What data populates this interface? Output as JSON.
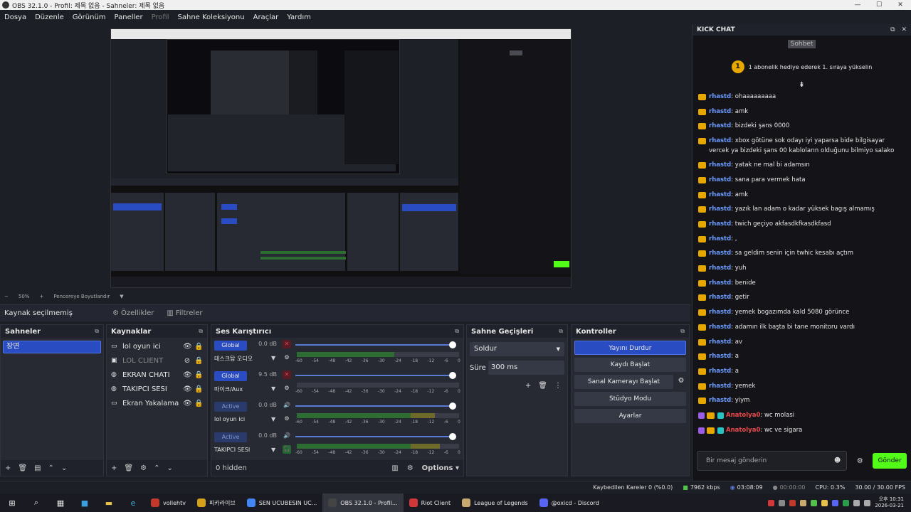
{
  "window": {
    "title": "OBS 32.1.0 - Profil: 제목 없음 - Sahneler: 제목 없음"
  },
  "menu": [
    "Dosya",
    "Düzenle",
    "Görünüm",
    "Paneller",
    "Profil",
    "Sahne Koleksiyonu",
    "Araçlar",
    "Yardım"
  ],
  "preview": {
    "zoom": "50%",
    "resize_label": "Pencereye Boyutlandır"
  },
  "context": {
    "label": "Kaynak seçilmemiş",
    "properties": "Özellikler",
    "filters": "Filtreler"
  },
  "scenes": {
    "title": "Sahneler",
    "items": [
      "장면"
    ]
  },
  "sources": {
    "title": "Kaynaklar",
    "items": [
      {
        "name": "lol oyun ici",
        "icon": "monitor-icon"
      },
      {
        "name": "LOL CLIENT",
        "icon": "window-icon"
      },
      {
        "name": "EKRAN CHATI",
        "icon": "browser-icon"
      },
      {
        "name": "TAKIPCI SESI",
        "icon": "browser-icon"
      },
      {
        "name": "Ekran Yakalama",
        "icon": "monitor-icon"
      }
    ]
  },
  "mixer": {
    "title": "Ses Karıştırıcı",
    "hidden": "0 hidden",
    "options": "Options",
    "channels": [
      {
        "badge": "Global",
        "db": "0.0 dB",
        "name": "데스크탑 오디오",
        "level": 0.6
      },
      {
        "badge": "Global",
        "db": "9.5 dB",
        "name": "마이크/Aux",
        "level": 0.0
      },
      {
        "badge": "Active",
        "db": "0.0 dB",
        "name": "lol oyun ici",
        "level": 0.85
      },
      {
        "badge": "Active",
        "db": "0.0 dB",
        "name": "TAKIPCI SESI",
        "level": 0.88
      }
    ],
    "ticks": [
      "-60",
      "-54",
      "-48",
      "-42",
      "-36",
      "-30",
      "-24",
      "-18",
      "-12",
      "-6",
      "0"
    ]
  },
  "transitions": {
    "title": "Sahne Geçişleri",
    "selected": "Soldur",
    "duration_label": "Süre",
    "duration": "300 ms"
  },
  "controls": {
    "title": "Kontroller",
    "stop_stream": "Yayını Durdur",
    "start_record": "Kaydı Başlat",
    "virtual_cam": "Sanal Kamerayı Başlat",
    "studio_mode": "Stüdyo Modu",
    "settings": "Ayarlar"
  },
  "status": {
    "dropped": "Kaybedilen Kareler 0 (%0.0)",
    "bitrate": "7962 kbps",
    "stream_time": "03:08:09",
    "rec_time": "00:00:00",
    "cpu": "CPU: 0.3%",
    "fps": "30.00 / 30.00 FPS"
  },
  "chat": {
    "title": "KICK CHAT",
    "tab": "Sohbet",
    "gift_rank": "1",
    "gift_text": "1 abonelik hediye ederek 1. sıraya yükselin",
    "messages": [
      {
        "user": "rhastd",
        "text": ": ohaaaaaaaaa"
      },
      {
        "user": "rhastd",
        "text": ": amk"
      },
      {
        "user": "rhastd",
        "text": ": bizdeki şans 0000"
      },
      {
        "user": "rhastd",
        "text": ": xbox götüne sok odayı iyi yaparsa bide bilgisayar vercek ya bizdeki şans 00 kabloların olduğunu bilmiyo salako",
        "wrap": true
      },
      {
        "user": "rhastd",
        "text": ": yatak ne mal bi adamsın"
      },
      {
        "user": "rhastd",
        "text": ": sana para vermek hata"
      },
      {
        "user": "rhastd",
        "text": ": amk"
      },
      {
        "user": "rhastd",
        "text": ": yazık lan adam o kadar yüksek bagış almamış"
      },
      {
        "user": "rhastd",
        "text": ": twich geçiyo akfasdkfkasdkfasd"
      },
      {
        "user": "rhastd",
        "text": ": ,"
      },
      {
        "user": "rhastd",
        "text": ": sa geldim senin için twhic kesabı açtım"
      },
      {
        "user": "rhastd",
        "text": ": yuh"
      },
      {
        "user": "rhastd",
        "text": ": benide"
      },
      {
        "user": "rhastd",
        "text": ": getir"
      },
      {
        "user": "rhastd",
        "text": ": yemek bogazımda kald 5080 görünce"
      },
      {
        "user": "rhastd",
        "text": ": adamın ilk başta bi tane monitoru vardı"
      },
      {
        "user": "rhastd",
        "text": ": av"
      },
      {
        "user": "rhastd",
        "text": ": a"
      },
      {
        "user": "rhastd",
        "text": ": a"
      },
      {
        "user": "rhastd",
        "text": ": yemek"
      },
      {
        "user": "rhastd",
        "text": ": yiym"
      },
      {
        "user": "Anatolya0",
        "text": ": wc molasi",
        "red": true
      },
      {
        "user": "Anatolya0",
        "text": ": wc ve sigara",
        "red": true
      }
    ],
    "input_placeholder": "Bir mesaj gönderin",
    "send": "Gönder"
  },
  "taskbar": {
    "tasks": [
      {
        "label": "vollehtv",
        "color": "#c0392b"
      },
      {
        "label": "피카라이브",
        "color": "#d4a017"
      },
      {
        "label": "SEN UCUBESIN UC...",
        "color": "#4285f4"
      },
      {
        "label": "OBS 32.1.0 - Profil...",
        "color": "#444444",
        "active": true
      },
      {
        "label": "Riot Client",
        "color": "#d13639"
      },
      {
        "label": "League of Legends",
        "color": "#c8aa6e"
      },
      {
        "label": "@oxicd - Discord",
        "color": "#5865f2"
      }
    ],
    "time": "오후 10:31",
    "date": "2026-03-21"
  }
}
